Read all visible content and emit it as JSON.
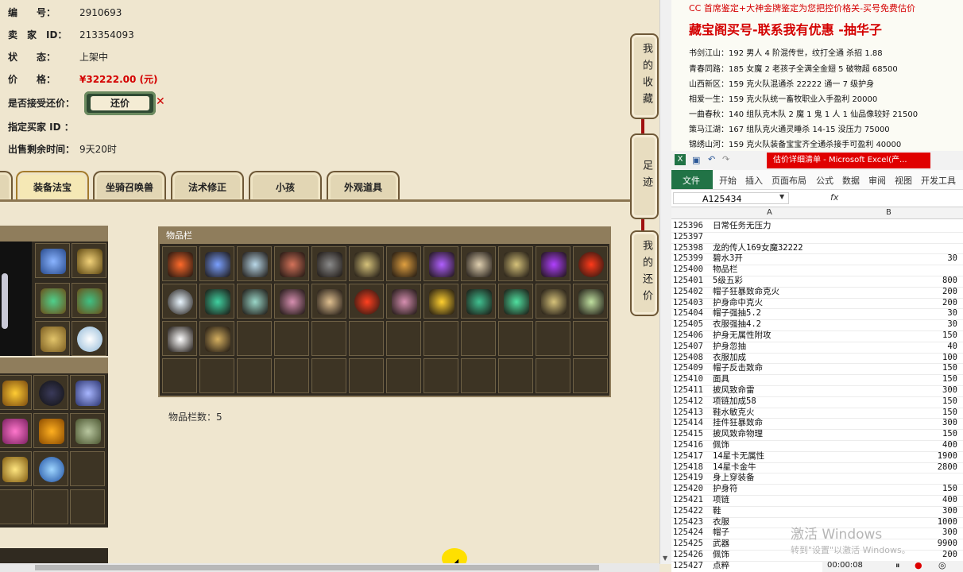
{
  "seller_info": {
    "number_label": "编　　号：",
    "number_value": "2910693",
    "seller_label": "卖　家　ID：",
    "seller_value": "213354093",
    "status_label": "状　　态：",
    "status_value": "上架中",
    "price_label": "价　　格：",
    "price_value": "¥32222.00 (元)",
    "counter_label": "是否接受还价：",
    "counter_button": "还价",
    "buyer_label": "指定买家 ID ：",
    "time_label": "出售剩余时间：",
    "time_value": "9天20时"
  },
  "tabs": [
    "装备法宝",
    "坐骑召唤兽",
    "法术修正",
    "小孩",
    "外观道具"
  ],
  "inventory": {
    "title": "物品栏",
    "count_text": "物品栏数：5"
  },
  "side_tabs": [
    "我的收藏",
    "足迹",
    "我的还价"
  ],
  "notes": {
    "line0": "CC 首席鉴定+大神金牌鉴定为您把控价格关-买号免费估价",
    "headline": "藏宝阁买号-联系我有优惠 -抽华子",
    "lines": [
      "书剑江山：192 男人 4 阶混传世，纹打全通 杀招 1.88",
      "青春同路：185 女魔 2 老孩子全满全金翅 5 破物超 68500",
      "山西新区：159 克火队混通杀 22222 通一 7 级护身",
      "相爱一生：159 克火队统一畜牧职业入手盈利 20000",
      "一曲春秋：140 组队克木队 2 魔 1 鬼 1 人 1 仙品像较好 21500",
      "策马江湖：167 组队克火通灵睡杀 14-15 没压力 75000",
      "锦绣山河：159 克火队装备宝宝齐全通杀接手可盈利 40000"
    ]
  },
  "excel": {
    "title": "估价详细清单 - Microsoft Excel(产...",
    "ribbon": [
      "文件",
      "开始",
      "插入",
      "页面布局",
      "公式",
      "数据",
      "审阅",
      "视图",
      "开发工具"
    ],
    "name_box": "A125434",
    "fx": "fx",
    "col_a": "A",
    "col_b": "B",
    "rows": [
      {
        "n": "125396",
        "a": "日常任务无压力",
        "b": ""
      },
      {
        "n": "125397",
        "a": "",
        "b": ""
      },
      {
        "n": "125398",
        "a": "龙的传人169女魔32222",
        "b": ""
      },
      {
        "n": "125399",
        "a": "碧水3开",
        "b": "30"
      },
      {
        "n": "125400",
        "a": "物品栏",
        "b": ""
      },
      {
        "n": "125401",
        "a": "5级五彩",
        "b": "800"
      },
      {
        "n": "125402",
        "a": "帽子狂暴致命克火",
        "b": "200"
      },
      {
        "n": "125403",
        "a": "护身命中克火",
        "b": "200"
      },
      {
        "n": "125404",
        "a": "帽子强抽5.2",
        "b": "30"
      },
      {
        "n": "125405",
        "a": "衣服强抽4.2",
        "b": "30"
      },
      {
        "n": "125406",
        "a": "护身无属性附攻",
        "b": "150"
      },
      {
        "n": "125407",
        "a": "护身忽抽",
        "b": "40"
      },
      {
        "n": "125408",
        "a": "衣服加成",
        "b": "100"
      },
      {
        "n": "125409",
        "a": "帽子反击致命",
        "b": "150"
      },
      {
        "n": "125410",
        "a": "面具",
        "b": "150"
      },
      {
        "n": "125411",
        "a": "披风致命雷",
        "b": "300"
      },
      {
        "n": "125412",
        "a": "项链加成58",
        "b": "150"
      },
      {
        "n": "125413",
        "a": "鞋水敏克火",
        "b": "150"
      },
      {
        "n": "125414",
        "a": "挂件狂暴致命",
        "b": "300"
      },
      {
        "n": "125415",
        "a": "披风致命物理",
        "b": "150"
      },
      {
        "n": "125416",
        "a": "佩饰",
        "b": "400"
      },
      {
        "n": "125417",
        "a": "14星卡无属性",
        "b": "1900"
      },
      {
        "n": "125418",
        "a": "14星卡金牛",
        "b": "2800"
      },
      {
        "n": "125419",
        "a": "身上穿装备",
        "b": ""
      },
      {
        "n": "125420",
        "a": "护身符",
        "b": "150"
      },
      {
        "n": "125421",
        "a": "项链",
        "b": "400"
      },
      {
        "n": "125422",
        "a": "鞋",
        "b": "300"
      },
      {
        "n": "125423",
        "a": "衣服",
        "b": "1000"
      },
      {
        "n": "125424",
        "a": "帽子",
        "b": "300"
      },
      {
        "n": "125425",
        "a": "武器",
        "b": "9900"
      },
      {
        "n": "125426",
        "a": "佩饰",
        "b": "200"
      },
      {
        "n": "125427",
        "a": "点粹",
        "b": ""
      }
    ]
  },
  "watermark": {
    "line1": "激活 Windows",
    "line2": "转到\"设置\"以激活 Windows。"
  },
  "player": {
    "time": "00:00:08"
  },
  "colors": {
    "price": "#d40000",
    "headline": "#d40000",
    "excel_green": "#217346",
    "excel_title_red": "#e00000"
  }
}
